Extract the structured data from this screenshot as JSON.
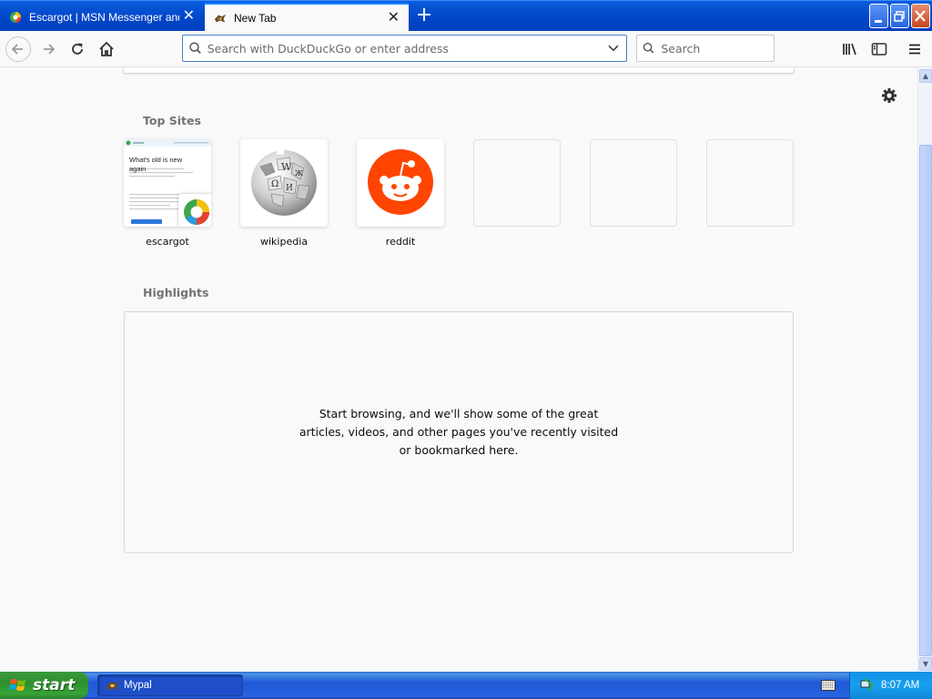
{
  "tabs": [
    {
      "label": "Escargot | MSN Messenger and W",
      "active": false
    },
    {
      "label": "New Tab",
      "active": true
    }
  ],
  "toolbar": {
    "url_placeholder": "Search with DuckDuckGo or enter address",
    "search_placeholder": "Search"
  },
  "newtab": {
    "top_sites_title": "Top Sites",
    "top_sites": [
      {
        "label": "escargot",
        "icon": "escargot-screenshot"
      },
      {
        "label": "wikipedia",
        "icon": "wikipedia-globe-icon"
      },
      {
        "label": "reddit",
        "icon": "reddit-icon"
      },
      {
        "label": "",
        "icon": ""
      },
      {
        "label": "",
        "icon": ""
      },
      {
        "label": "",
        "icon": ""
      }
    ],
    "escargot_preview": {
      "headline": "What's old is new again"
    },
    "highlights_title": "Highlights",
    "highlights_message": "Start browsing, and we'll show some of the great articles, videos, and other pages you've recently visited or bookmarked here."
  },
  "taskbar": {
    "start_label": "start",
    "tasks": [
      {
        "label": "Mypal",
        "icon": "mypal-icon"
      }
    ],
    "clock": "8:07 AM"
  },
  "colors": {
    "xp_blue": "#0046c8",
    "accent": "#0a84ff",
    "reddit": "#ff4500",
    "start_green": "#36a436"
  }
}
